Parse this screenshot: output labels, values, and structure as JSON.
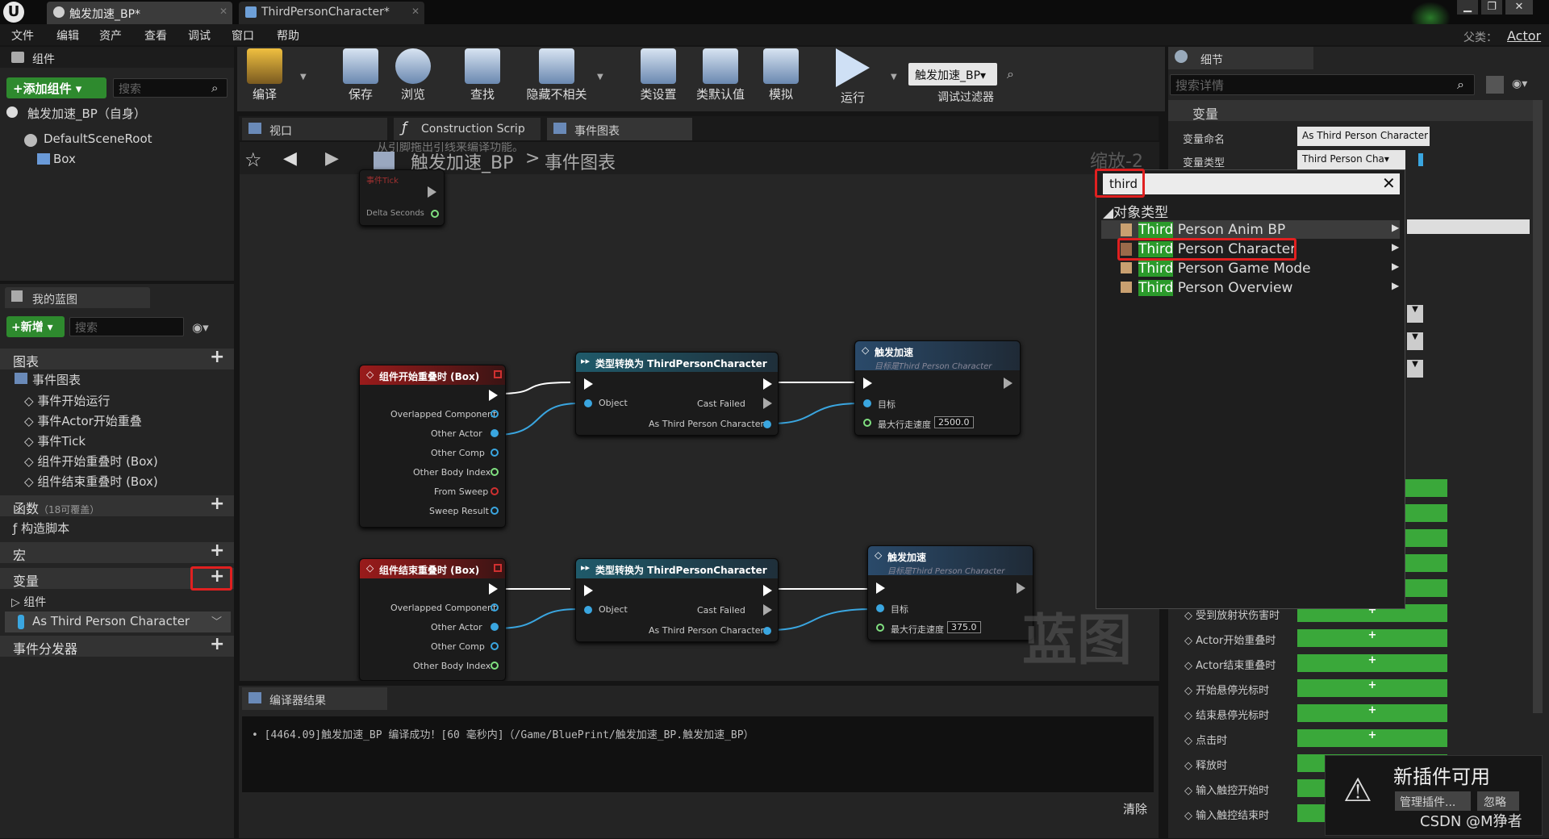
{
  "window": {
    "tabs": [
      {
        "label": "触发加速_BP*"
      },
      {
        "label": "ThirdPersonCharacter*"
      }
    ],
    "parent_label": "父类：",
    "parent_value": "Actor"
  },
  "menu": [
    "文件",
    "编辑",
    "资产",
    "查看",
    "调试",
    "窗口",
    "帮助"
  ],
  "components_panel": {
    "title": "组件",
    "add_button": "+添加组件 ▾",
    "search_placeholder": "搜索",
    "self_item": "触发加速_BP（自身）",
    "tree": [
      "DefaultSceneRoot",
      "Box"
    ]
  },
  "my_blueprint": {
    "title": "我的蓝图",
    "new_button": "+新增 ▾",
    "search_placeholder": "搜索",
    "graphs_label": "图表",
    "event_graph": "事件图表",
    "events": [
      "事件开始运行",
      "事件Actor开始重叠",
      "事件Tick",
      "组件开始重叠时 (Box)",
      "组件结束重叠时 (Box)"
    ],
    "functions_label": "函数",
    "functions_note": "（18可覆盖）",
    "construction": "构造脚本",
    "macros_label": "宏",
    "variables_label": "变量",
    "components_label": "组件",
    "variable_item": "As Third Person Character",
    "dispatchers_label": "事件分发器"
  },
  "toolbar": [
    {
      "label": "编译",
      "icon": "compile-icon"
    },
    {
      "label": "保存",
      "icon": "save-icon"
    },
    {
      "label": "浏览",
      "icon": "browse-icon"
    },
    {
      "label": "查找",
      "icon": "find-icon"
    },
    {
      "label": "隐藏不相关",
      "icon": "hide-unrelated-icon"
    },
    {
      "label": "类设置",
      "icon": "class-settings-icon"
    },
    {
      "label": "类默认值",
      "icon": "class-defaults-icon"
    },
    {
      "label": "模拟",
      "icon": "simulate-icon"
    },
    {
      "label": "运行",
      "icon": "play-icon"
    }
  ],
  "debug_filter": {
    "value": "触发加速_BP▾",
    "label": "调试过滤器"
  },
  "editor_tabs": [
    "视口",
    "Construction Scrip",
    "事件图表"
  ],
  "graph": {
    "breadcrumb_root": "触发加速_BP",
    "breadcrumb_sep": ">",
    "breadcrumb_leaf": "事件图表",
    "zoom": "缩放-2",
    "hint": "从引脚拖出引线来编译功能。",
    "tick_title": "事件Tick",
    "tick_pin": "Delta Seconds",
    "watermark": "蓝图",
    "node_begin_title": "组件开始重叠时 (Box)",
    "node_end_title": "组件结束重叠时 (Box)",
    "overlap_pins_begin": [
      "Overlapped Component",
      "Other Actor",
      "Other Comp",
      "Other Body Index",
      "From Sweep",
      "Sweep Result"
    ],
    "overlap_pins_end": [
      "Overlapped Component",
      "Other Actor",
      "Other Comp",
      "Other Body Index"
    ],
    "cast_title": "类型转换为 ThirdPersonCharacter",
    "cast_object": "Object",
    "cast_failed": "Cast Failed",
    "cast_as": "As Third Person Character",
    "func_title": "触发加速",
    "func_subtitle": "目标是Third Person Character",
    "func_target": "目标",
    "func_speed_label": "最大行走速度",
    "speed_top": "2500.0",
    "speed_bottom": "375.0"
  },
  "details": {
    "title": "细节",
    "search_placeholder": "搜索详情",
    "section": "变量",
    "var_name_label": "变量命名",
    "var_name_value": "As Third Person Character",
    "var_type_label": "变量类型",
    "var_type_value": "Third Person Cha▾",
    "events": [
      "受到放射状伤害时",
      "Actor开始重叠时",
      "Actor结束重叠时",
      "开始悬停光标时",
      "结束悬停光标时",
      "点击时",
      "释放时",
      "输入触控开始时",
      "输入触控结束时"
    ]
  },
  "type_popup": {
    "search_value": "third",
    "category": "对象类型",
    "items": [
      {
        "match": "Third",
        "rest": " Person Anim BP"
      },
      {
        "match": "Third",
        "rest": " Person Character"
      },
      {
        "match": "Third",
        "rest": " Person Game Mode"
      },
      {
        "match": "Third",
        "rest": " Person Overview"
      }
    ]
  },
  "compiler": {
    "tab": "编译器结果",
    "message": "[4464.09]触发加速_BP 编译成功！[60 毫秒内]（/Game/BluePrint/触发加速_BP.触发加速_BP）",
    "clear": "清除"
  },
  "notification": {
    "title": "新插件可用",
    "manage": "管理插件...",
    "ignore": "忽略"
  },
  "watermark_text": "CSDN @M狰者"
}
